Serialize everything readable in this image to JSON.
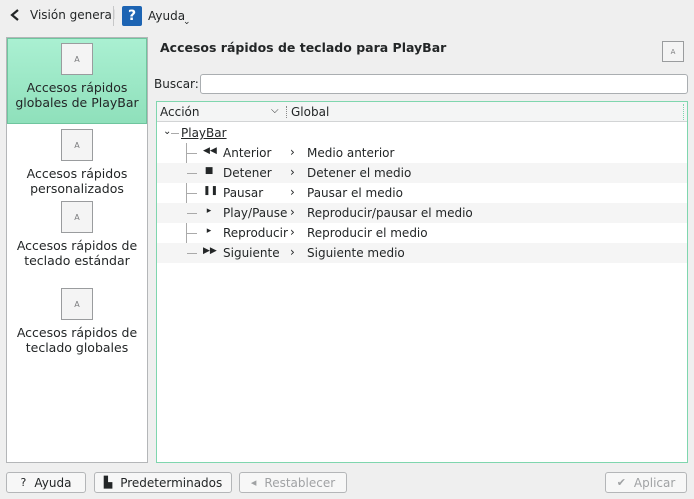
{
  "toolbar": {
    "back_label": "Visión general",
    "help_label": "Ayuda",
    "help_badge": "?"
  },
  "sidebar": {
    "items": [
      {
        "label": "Accesos rápidos globales de PlayBar",
        "icon_text": "A",
        "active": true
      },
      {
        "label": "Accesos rápidos personalizados",
        "icon_text": "A",
        "active": false
      },
      {
        "label": "Accesos rápidos de teclado estándar",
        "icon_text": "A",
        "active": false
      },
      {
        "label": "Accesos rápidos de teclado globales",
        "icon_text": "A",
        "active": false
      }
    ]
  },
  "main": {
    "title": "Accesos rápidos de teclado para PlayBar",
    "corner_icon_text": "A",
    "search": {
      "label": "Buscar:",
      "value": "",
      "placeholder": ""
    },
    "columns": {
      "accion": "Acción",
      "global": "Global"
    },
    "root": "PlayBar",
    "rows": [
      {
        "icon": "skip-back-icon",
        "glyph": "◀◀",
        "name": "Anterior",
        "global": "Medio anterior"
      },
      {
        "icon": "stop-icon",
        "glyph": "■",
        "name": "Detener",
        "global": "Detener el medio"
      },
      {
        "icon": "pause-icon",
        "glyph": "❚❚",
        "name": "Pausar",
        "global": "Pausar el medio"
      },
      {
        "icon": "play-icon",
        "glyph": "▸",
        "name": "Play/Pause",
        "global": "Reproducir/pausar el medio"
      },
      {
        "icon": "play-icon",
        "glyph": "▸",
        "name": "Reproducir",
        "global": "Reproducir el medio"
      },
      {
        "icon": "skip-forward-icon",
        "glyph": "▶▶",
        "name": "Siguiente",
        "global": "Siguiente medio"
      }
    ]
  },
  "buttons": {
    "help": "Ayuda",
    "defaults": "Predeterminados",
    "reset": "Restablecer",
    "apply": "Aplicar"
  },
  "colors": {
    "selection": "#9de6c6",
    "help_badge": "#1d64b3",
    "tree_border": "#7fd6ae"
  }
}
